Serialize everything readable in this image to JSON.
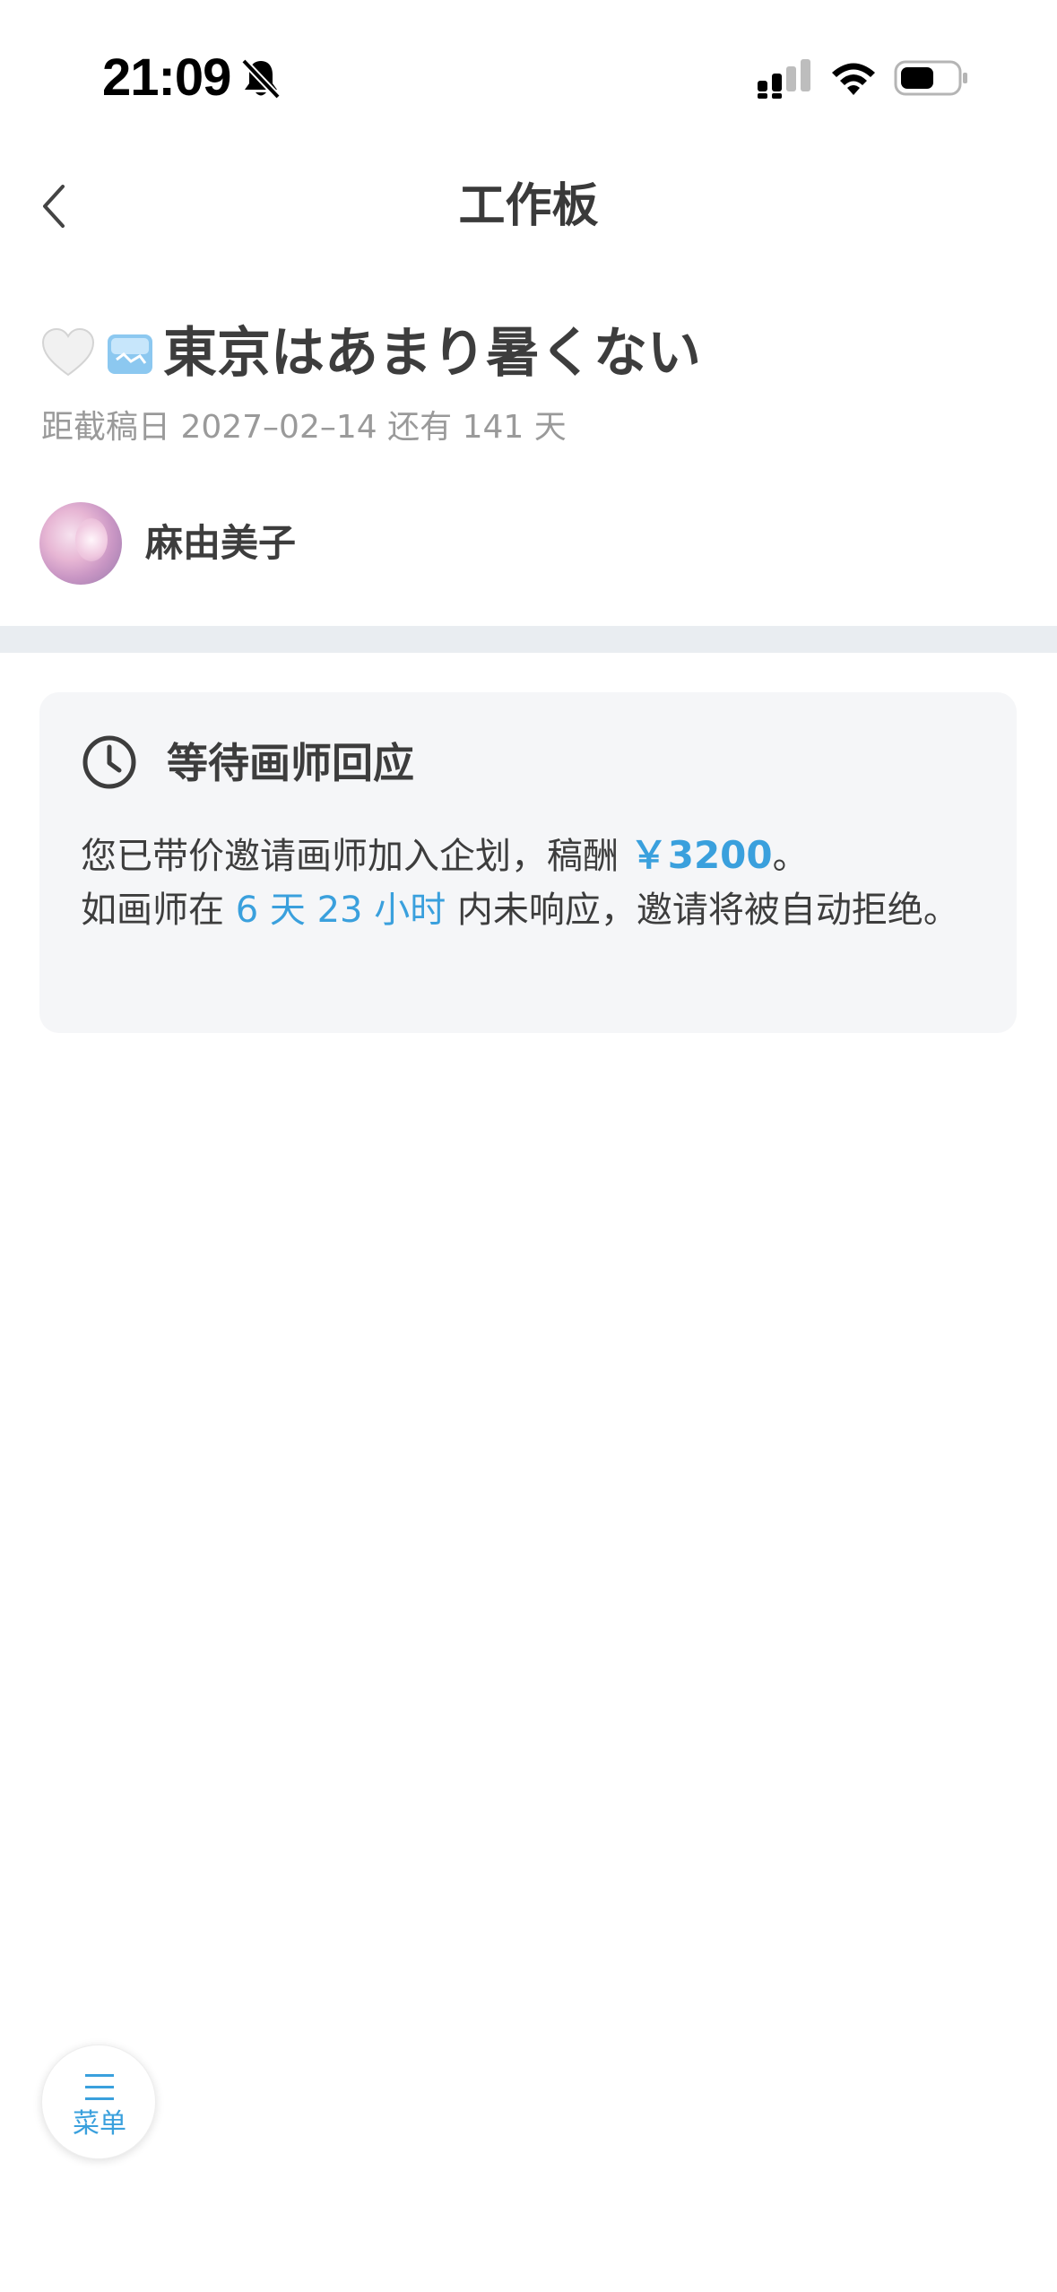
{
  "status_bar": {
    "time": "21:09"
  },
  "nav": {
    "title": "工作板"
  },
  "project": {
    "title": "東京はあまり暑くない",
    "deadline": "距截稿日 2027–02–14 还有 141 天",
    "owner_name": "麻由美子"
  },
  "status_card": {
    "title": "等待画师回应",
    "line1_prefix": "您已带价邀请画师加入企划，稿酬 ",
    "fee": "￥3200",
    "line1_suffix": "。",
    "line2_prefix": "如画师在 ",
    "remaining_time": "6 天 23 小时",
    "line2_suffix": " 内未响应，邀请将被自动拒绝。"
  },
  "menu": {
    "label": "菜单"
  },
  "colors": {
    "accent": "#3aa0dd",
    "divider": "#e9edf1",
    "card_bg": "#f5f6f8"
  }
}
